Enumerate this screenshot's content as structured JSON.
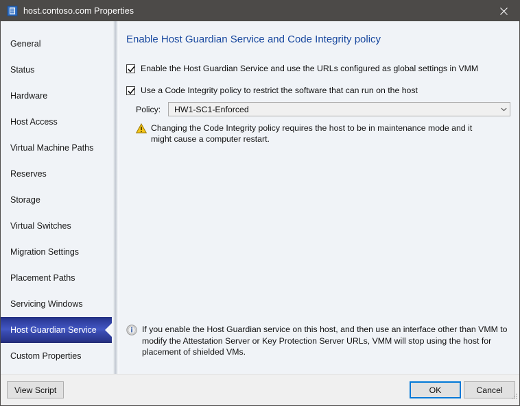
{
  "window": {
    "title": "host.contoso.com Properties",
    "icon": "server-properties-icon",
    "close_label": "close-icon"
  },
  "sidebar": {
    "items": [
      {
        "label": "General",
        "selected": false
      },
      {
        "label": "Status",
        "selected": false
      },
      {
        "label": "Hardware",
        "selected": false
      },
      {
        "label": "Host Access",
        "selected": false
      },
      {
        "label": "Virtual Machine Paths",
        "selected": false
      },
      {
        "label": "Reserves",
        "selected": false
      },
      {
        "label": "Storage",
        "selected": false
      },
      {
        "label": "Virtual Switches",
        "selected": false
      },
      {
        "label": "Migration Settings",
        "selected": false
      },
      {
        "label": "Placement Paths",
        "selected": false
      },
      {
        "label": "Servicing Windows",
        "selected": false
      },
      {
        "label": "Host Guardian Service",
        "selected": true
      },
      {
        "label": "Custom Properties",
        "selected": false
      }
    ]
  },
  "content": {
    "title": "Enable Host Guardian Service and Code Integrity policy",
    "checkbox_hgs": {
      "label": "Enable the Host Guardian Service and use the URLs configured as global settings in VMM",
      "checked": true
    },
    "checkbox_ci": {
      "label": "Use a Code Integrity policy to restrict the software that can run on the host",
      "checked": true
    },
    "policy": {
      "label": "Policy:",
      "value": "HW1-SC1-Enforced"
    },
    "warning": {
      "icon": "warning-triangle-icon",
      "text": "Changing the Code Integrity policy requires the host to be in maintenance mode and it might cause a computer restart."
    },
    "info": {
      "icon": "information-icon",
      "text": "If you enable the Host Guardian service on this host, and then use an interface other than VMM to modify the Attestation Server or Key Protection Server URLs, VMM will stop using the host for placement of shielded VMs."
    }
  },
  "footer": {
    "view_script_label": "View Script",
    "ok_label": "OK",
    "cancel_label": "Cancel"
  },
  "colors": {
    "titlebar": "#4c4a48",
    "accent_heading": "#17479e",
    "selected_item": "#3a4cb2",
    "focus_border": "#0078d7",
    "panel_bg": "#f0f3f7"
  }
}
